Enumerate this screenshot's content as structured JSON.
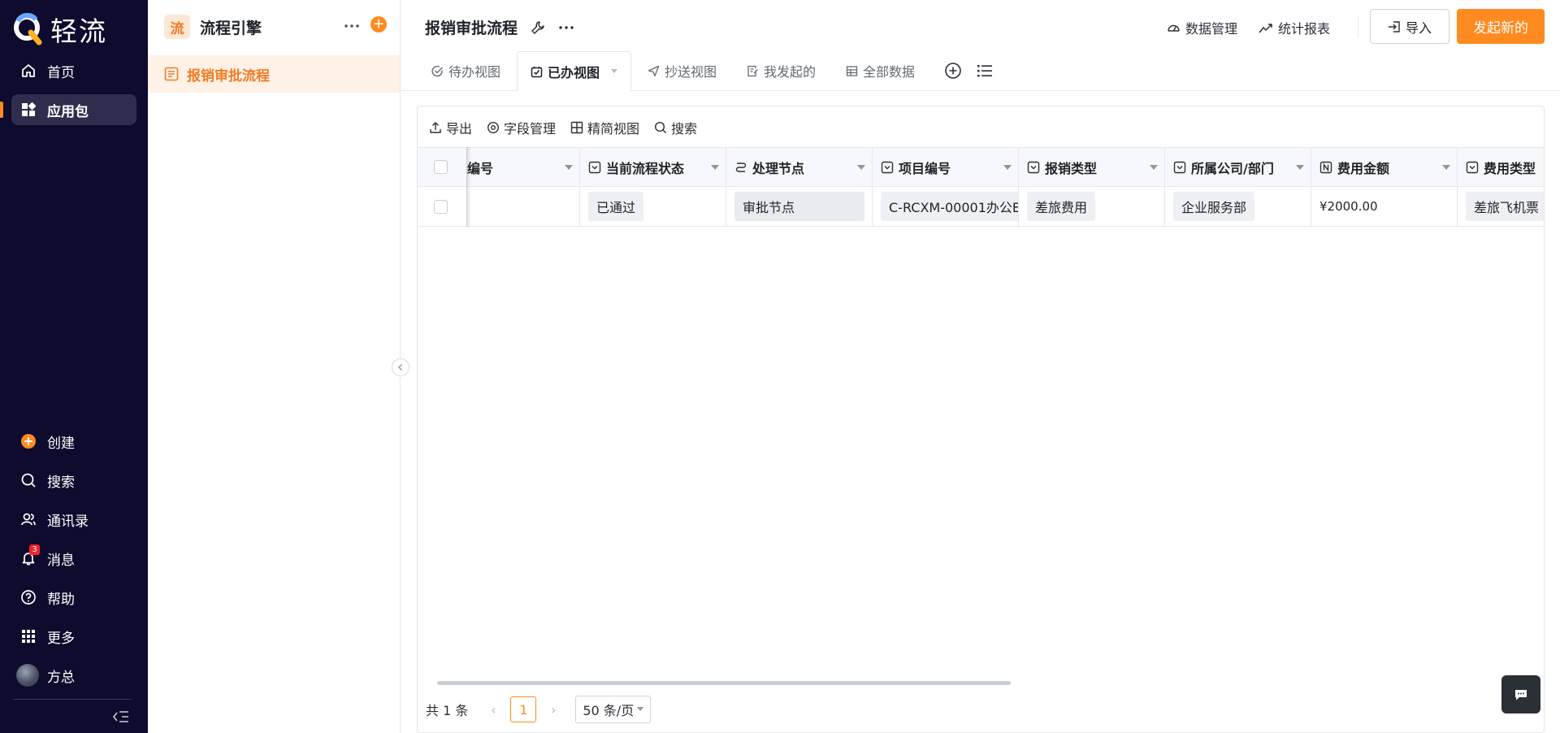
{
  "brand": {
    "name": "轻流"
  },
  "nav": {
    "top_items": [
      {
        "label": "首页",
        "icon": "home-icon"
      },
      {
        "label": "应用包",
        "icon": "apps-icon"
      }
    ],
    "bottom_items": [
      {
        "label": "创建",
        "icon": "plus-circle-icon"
      },
      {
        "label": "搜索",
        "icon": "search-icon"
      },
      {
        "label": "通讯录",
        "icon": "contacts-icon"
      },
      {
        "label": "消息",
        "icon": "bell-icon",
        "badge": "3"
      },
      {
        "label": "帮助",
        "icon": "help-icon"
      },
      {
        "label": "更多",
        "icon": "grid-icon"
      },
      {
        "label": "方总",
        "icon": "avatar"
      }
    ],
    "accent": "#ff8a1f"
  },
  "sidebar": {
    "logo_char": "流",
    "title": "流程引擎",
    "items": [
      {
        "label": "报销审批流程",
        "icon": "form-icon"
      }
    ]
  },
  "header": {
    "title": "报销审批流程",
    "data_mgmt": "数据管理",
    "report": "统计报表",
    "import": "导入",
    "start": "发起新的"
  },
  "tabs": [
    {
      "label": "待办视图",
      "icon": "check-circle-icon"
    },
    {
      "label": "已办视图",
      "icon": "check-square-icon",
      "active": true
    },
    {
      "label": "抄送视图",
      "icon": "send-icon"
    },
    {
      "label": "我发起的",
      "icon": "doc-edit-icon"
    },
    {
      "label": "全部数据",
      "icon": "table-icon"
    }
  ],
  "toolbar": {
    "export": "导出",
    "fields": "字段管理",
    "compact": "精简视图",
    "search": "搜索"
  },
  "table": {
    "columns": [
      {
        "label": "编号",
        "icon": ""
      },
      {
        "label": "当前流程状态",
        "icon": "select-icon"
      },
      {
        "label": "处理节点",
        "icon": "flow-icon"
      },
      {
        "label": "项目编号",
        "icon": "select-icon"
      },
      {
        "label": "报销类型",
        "icon": "select-icon"
      },
      {
        "label": "所属公司/部门",
        "icon": "select-icon"
      },
      {
        "label": "费用金额",
        "icon": "number-icon"
      },
      {
        "label": "费用类型",
        "icon": "select-icon"
      }
    ],
    "rows": [
      [
        "",
        "已通过",
        "审批节点",
        "C-RCXM-00001办公E",
        "差旅费用",
        "企业服务部",
        "¥2000.00",
        "差旅飞机票"
      ]
    ]
  },
  "pager": {
    "total": "共 1 条",
    "current": "1",
    "size": "50 条/页"
  }
}
